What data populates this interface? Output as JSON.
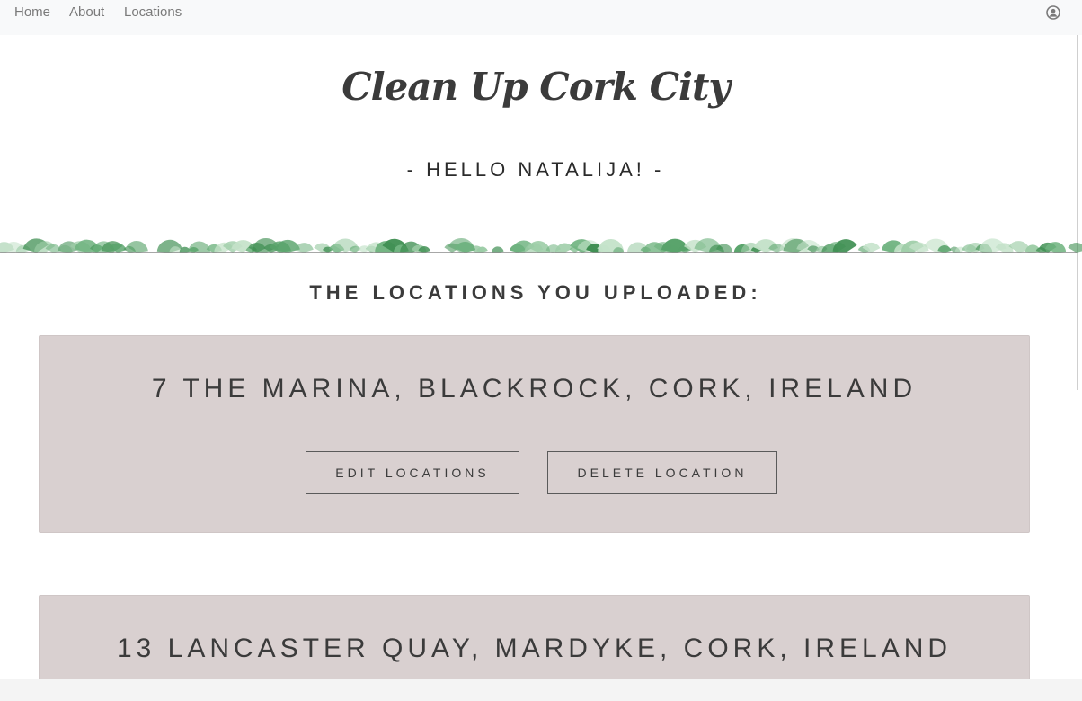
{
  "nav": {
    "links": [
      "Home",
      "About",
      "Locations"
    ],
    "user_icon": "user-circle-icon"
  },
  "brand": "Clean Up Cork City",
  "greeting": "- HELLO NATALIJA! -",
  "section_title": "THE LOCATIONS YOU UPLOADED:",
  "locations": [
    {
      "address": "7 THE MARINA, BLACKROCK, CORK, IRELAND",
      "edit_label": "EDIT LOCATIONS",
      "delete_label": "DELETE LOCATION"
    },
    {
      "address": "13 LANCASTER QUAY, MARDYKE, CORK, IRELAND"
    }
  ],
  "colors": {
    "card_bg": "#d9d0d0",
    "nav_bg": "#f8f9fa",
    "leaf_green": "#4a9a5c"
  }
}
